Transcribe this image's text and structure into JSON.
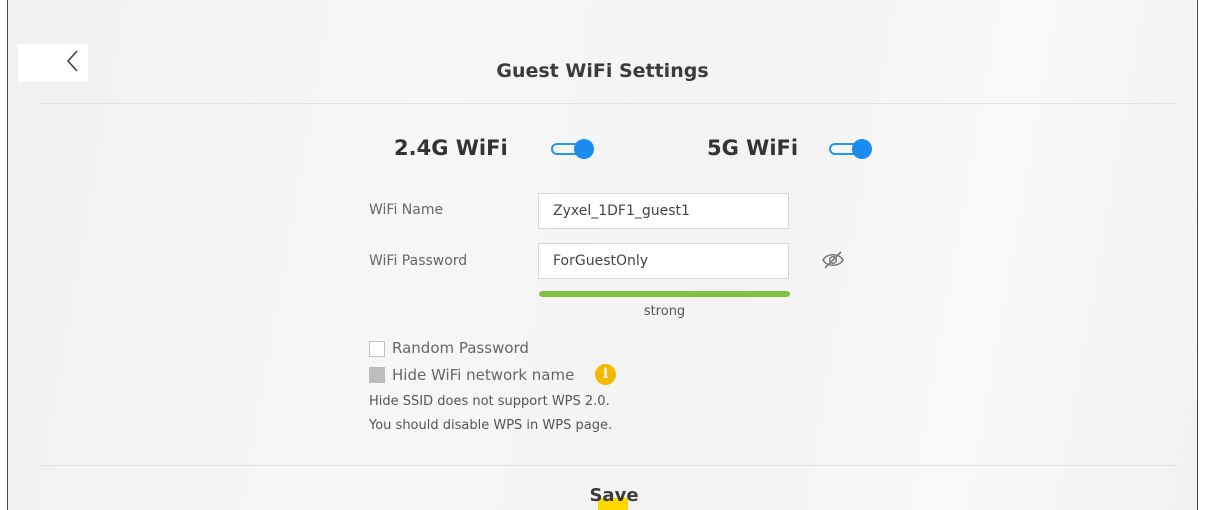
{
  "header": {
    "title": "Guest WiFi Settings",
    "back_icon": "chevron-left-icon"
  },
  "bands": [
    {
      "label": "2.4G WiFi",
      "enabled": true
    },
    {
      "label": "5G WiFi",
      "enabled": true
    }
  ],
  "form": {
    "wifi_name_label": "WiFi Name",
    "wifi_name_value": "Zyxel_1DF1_guest1",
    "wifi_password_label": "WiFi Password",
    "wifi_password_value": "ForGuestOnly",
    "password_visibility_icon": "eye-off-icon",
    "strength_label": "strong",
    "strength_level": 1.0,
    "strength_color": "#7fc241"
  },
  "options": {
    "random_password_label": "Random Password",
    "random_password_checked": false,
    "hide_ssid_label": "Hide WiFi network name",
    "hide_ssid_checked": false,
    "info_icon": "info-icon",
    "info_icon_color": "#f5b800"
  },
  "notes": {
    "line1": "Hide SSID does not support WPS 2.0.",
    "line2": "You should disable WPS in WPS page."
  },
  "footer": {
    "save_label": "Save",
    "save_highlight_color": "#ffd800"
  },
  "colors": {
    "toggle_accent": "#1a8cf0"
  }
}
